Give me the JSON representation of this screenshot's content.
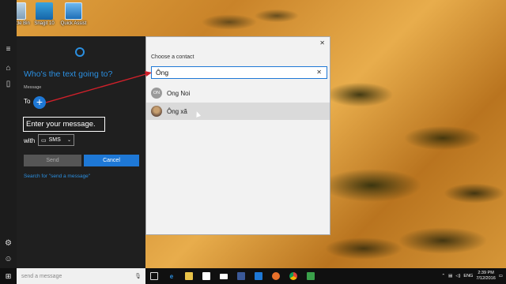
{
  "desktop": {
    "icons": [
      {
        "label": "Recycle Bin"
      },
      {
        "label": "Snagit 10"
      },
      {
        "label": "Quick Assist"
      }
    ]
  },
  "cortana": {
    "title": "Who's the text going to?",
    "message_label": "Message",
    "to_label": "To",
    "plus": "+",
    "message_value": "Enter your message.",
    "with_label": "with",
    "sms_label": "SMS",
    "send_label": "Send",
    "cancel_label": "Cancel",
    "search_link": "Search for \"send a message\""
  },
  "chooser": {
    "title": "Choose a contact",
    "search_value": "Ông",
    "contacts": [
      {
        "initials": "ON",
        "name": "Ong Noi"
      },
      {
        "initials": "",
        "name": "Ông xã"
      }
    ]
  },
  "taskbar": {
    "search_placeholder": "send a message",
    "language": "ENG",
    "time": "2:39 PM",
    "date": "7/12/2016"
  },
  "colors": {
    "accent": "#1e78d6",
    "cortana_bg": "#1f1f1f",
    "annotation_arrow": "#d0202a"
  }
}
